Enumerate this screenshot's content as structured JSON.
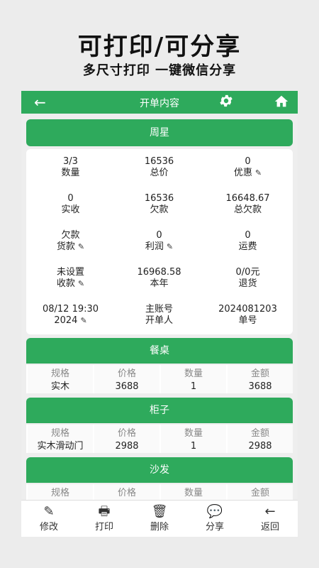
{
  "promo": {
    "title": "可打印/可分享",
    "subtitle": "多尺寸打印 一键微信分享"
  },
  "topbar": {
    "title": "开单内容",
    "back_icon": "←"
  },
  "customer": "周星",
  "summary": [
    {
      "value": "3/3",
      "label": "数量"
    },
    {
      "value": "16536",
      "label": "总价"
    },
    {
      "value": "0",
      "label": "优惠",
      "editable": true
    },
    {
      "value": "0",
      "label": "实收"
    },
    {
      "value": "16536",
      "label": "欠款"
    },
    {
      "value": "16648.67",
      "label": "总欠款"
    },
    {
      "value": "欠款",
      "label": "货款",
      "editable": true
    },
    {
      "value": "0",
      "label": "利润",
      "editable": true
    },
    {
      "value": "0",
      "label": "运费"
    },
    {
      "value": "未设置",
      "label": "收款",
      "editable": true
    },
    {
      "value": "16968.58",
      "label": "本年"
    },
    {
      "value": "0/0元",
      "label": "退货"
    },
    {
      "value": "08/12 19:30",
      "label": "2024",
      "editable": true
    },
    {
      "value": "主账号",
      "label": "开单人"
    },
    {
      "value": "2024081203",
      "label": "单号"
    }
  ],
  "edit_icon": "✎",
  "columns": [
    "规格",
    "价格",
    "数量",
    "金额"
  ],
  "items": [
    {
      "name": "餐桌",
      "spec": "实木",
      "price": "3688",
      "qty": "1",
      "amount": "3688"
    },
    {
      "name": "柜子",
      "spec": "实木滑动门",
      "price": "2988",
      "qty": "1",
      "amount": "2988"
    },
    {
      "name": "沙发",
      "spec": "",
      "price": "",
      "qty": "",
      "amount": ""
    }
  ],
  "toolbar": [
    {
      "label": "修改",
      "icon": "pencil-icon",
      "glyph": "✎"
    },
    {
      "label": "打印",
      "icon": "printer-icon",
      "glyph": "🖶"
    },
    {
      "label": "删除",
      "icon": "trash-icon",
      "glyph": "🗑"
    },
    {
      "label": "分享",
      "icon": "wechat-icon",
      "glyph": "💬"
    },
    {
      "label": "返回",
      "icon": "back-arrow-icon",
      "glyph": "←"
    }
  ],
  "colors": {
    "accent": "#2eaa5c",
    "background": "#eeeeee"
  }
}
